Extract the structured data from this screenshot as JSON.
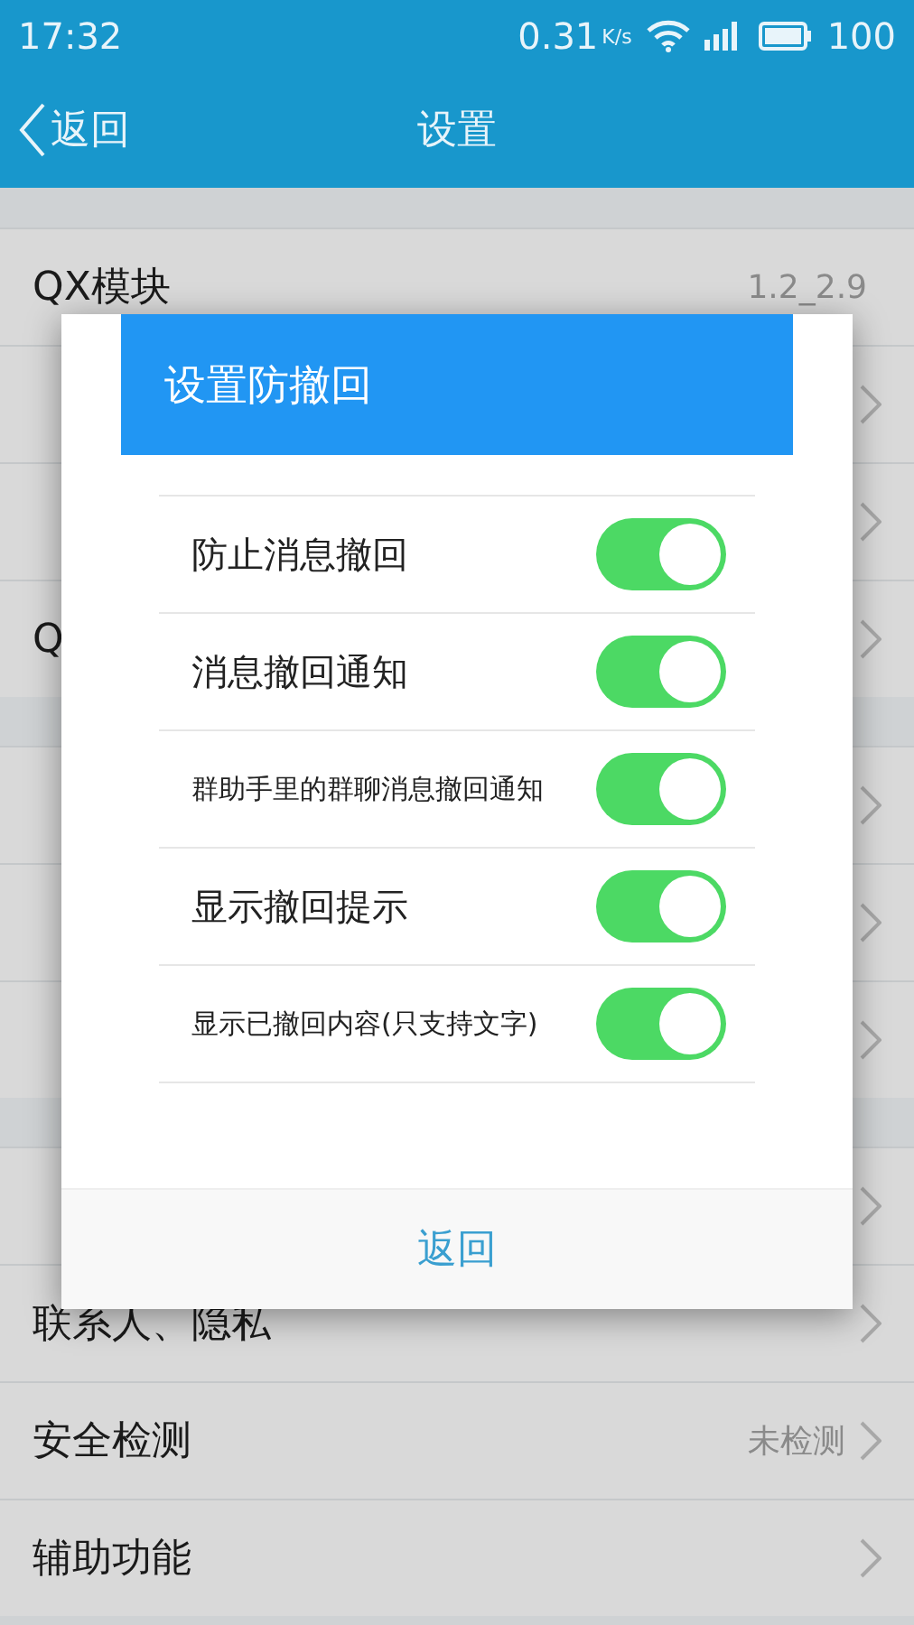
{
  "status_bar": {
    "time": "17:32",
    "speed": "0.31",
    "speed_unit": "K/s",
    "battery": "100"
  },
  "header": {
    "back": "返回",
    "title": "设置"
  },
  "sections": [
    {
      "rows": [
        {
          "label": "QX模块",
          "value": "1.2_2.9",
          "chevron": false
        },
        {
          "chevron": true
        },
        {
          "chevron": true
        },
        {
          "label": "Q",
          "chevron": true
        }
      ]
    },
    {
      "rows": [
        {
          "chevron": true
        },
        {
          "chevron": true
        },
        {
          "chevron": true
        }
      ]
    },
    {
      "rows": [
        {
          "chevron": true
        },
        {
          "label": "联系人、隐私",
          "chevron": true
        },
        {
          "label": "安全检测",
          "value": "未检测",
          "chevron": true
        },
        {
          "label": "辅助功能",
          "chevron": true
        }
      ]
    }
  ],
  "dialog": {
    "title": "设置防撤回",
    "options": [
      {
        "label": "防止消息撤回",
        "on": true,
        "small": false
      },
      {
        "label": "消息撤回通知",
        "on": true,
        "small": false
      },
      {
        "label": "群助手里的群聊消息撤回通知",
        "on": true,
        "small": true
      },
      {
        "label": "显示撤回提示",
        "on": true,
        "small": false
      },
      {
        "label": "显示已撤回内容(只支持文字)",
        "on": true,
        "small": true
      }
    ],
    "button": "返回"
  }
}
